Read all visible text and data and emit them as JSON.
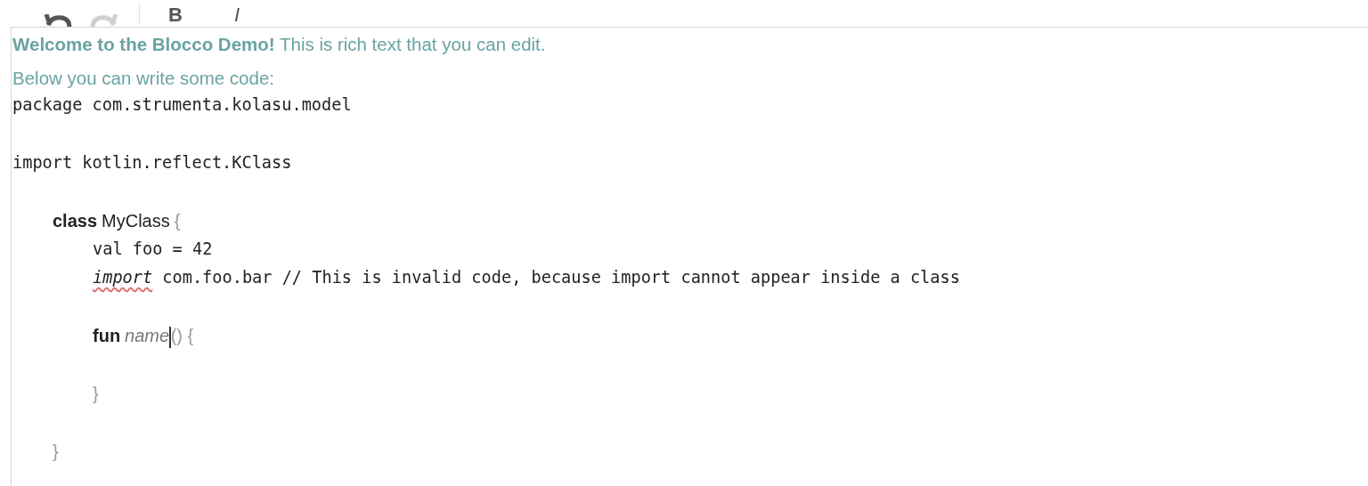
{
  "toolbar": [
    {
      "kind": "undo",
      "disabled": false
    },
    {
      "kind": "redo",
      "disabled": true
    },
    {
      "kind": "separator"
    },
    {
      "kind": "bold",
      "label": "B"
    },
    {
      "kind": "italic",
      "label": "I"
    }
  ],
  "intro": [
    "**Welcome to the Blocco Demo!** This is rich text that you can edit.",
    "Below you can write some code:"
  ],
  "code": [
    {
      "kind": "code",
      "text": "package com.strumenta.kolasu.model"
    },
    {
      "kind": "blank"
    },
    {
      "kind": "code",
      "text": "import kotlin.reflect.KClass"
    },
    {
      "kind": "blank"
    },
    {
      "kind": "block",
      "keyword": "class",
      "name": "MyClass",
      "italic_name": false,
      "open": "{",
      "close": "}",
      "caret": false,
      "children": [
        {
          "kind": "code",
          "text": "val foo = 42"
        },
        {
          "kind": "invalid",
          "keyword": "import",
          "text": "com.foo.bar // This is invalid code, because import cannot appear inside a class",
          "spell_error": true
        },
        {
          "kind": "blank"
        },
        {
          "kind": "block",
          "keyword": "fun",
          "name": "name",
          "italic_name": true,
          "open": "() {",
          "close": "}",
          "caret": true,
          "children": [
            {
              "kind": "blank"
            }
          ]
        },
        {
          "kind": "blank"
        }
      ]
    }
  ]
}
